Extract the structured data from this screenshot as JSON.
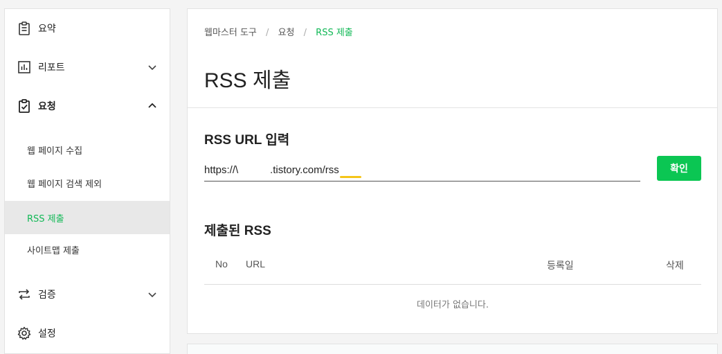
{
  "sidebar": {
    "items": [
      {
        "label": "요약",
        "icon": "clipboard-icon"
      },
      {
        "label": "리포트",
        "icon": "bar-chart-icon",
        "chevron": "down"
      },
      {
        "label": "요청",
        "icon": "clipboard-check-icon",
        "chevron": "up"
      },
      {
        "label": "검증",
        "icon": "repeat-arrows-icon",
        "chevron": "down"
      },
      {
        "label": "설정",
        "icon": "gear-icon"
      }
    ],
    "subitems": [
      {
        "label": "웹 페이지 수집"
      },
      {
        "label": "웹 페이지 검색 제외"
      },
      {
        "label": "RSS 제출",
        "active": true
      },
      {
        "label": "사이트맵 제출"
      }
    ]
  },
  "breadcrumb": {
    "items": [
      "웹마스터 도구",
      "요청",
      "RSS 제출"
    ],
    "separator": "/"
  },
  "main": {
    "title": "RSS 제출",
    "input_section": {
      "title": "RSS URL 입력",
      "url_value": "https://\\           .tistory.com/rss",
      "confirm_label": "확인"
    },
    "submitted_section": {
      "title": "제출된 RSS",
      "columns": [
        "No",
        "URL",
        "등록일",
        "삭제"
      ],
      "empty_message": "데이터가 없습니다."
    }
  },
  "colors": {
    "accent": "#0bc653",
    "active_text": "#11b856",
    "highlight": "#f5c518"
  }
}
